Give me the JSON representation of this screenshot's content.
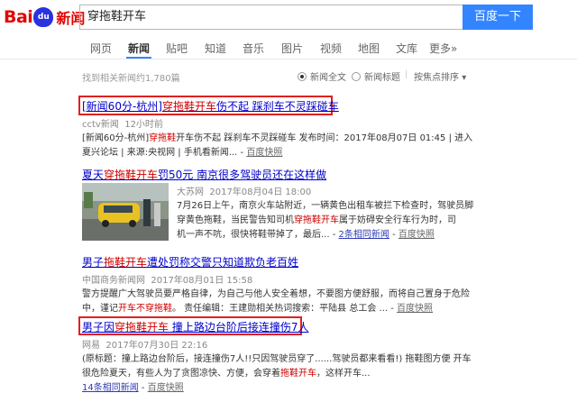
{
  "header": {
    "logo_text_1": "Bai",
    "logo_paw": "du",
    "logo_text_2": "新闻",
    "search_query": "穿拖鞋开车",
    "search_button": "百度一下"
  },
  "nav": {
    "items": [
      {
        "label": "网页"
      },
      {
        "label": "新闻"
      },
      {
        "label": "贴吧"
      },
      {
        "label": "知道"
      },
      {
        "label": "音乐"
      },
      {
        "label": "图片"
      },
      {
        "label": "视频"
      },
      {
        "label": "地图"
      },
      {
        "label": "文库"
      },
      {
        "label": "更多»"
      }
    ],
    "active": "新闻"
  },
  "toolbar": {
    "result_count": "找到相关新闻约1,780篇",
    "option_full": "新闻全文",
    "option_title": "新闻标题",
    "sort": "按焦点排序"
  },
  "results": [
    {
      "title_pre": "[新闻60分-杭州]",
      "title_em": "穿拖鞋开车",
      "title_post": "伤不起 踩刹车不灵踩碰车",
      "source": "cctv新闻",
      "time": "12小时前",
      "snippet_1_pre": "[新闻60分-杭州]",
      "snippet_1_em": "穿拖鞋",
      "snippet_1_post": "开车伤不起 踩刹车不灵踩碰车 发布时间：2017年08月07日 01:45 | 进入",
      "snippet_2": "夏兴论坛 | 来源:央视网 | 手机看新闻...",
      "cache": "百度快照"
    },
    {
      "title_pre": "夏天",
      "title_em": "穿拖鞋开车",
      "title_post": "罚50元 南京很多驾驶员还在这样做",
      "source": "大苏网",
      "time": "2017年08月04日 18:00",
      "snippet_1": "7月26日上午，南京火车站附近，一辆黄色出租车被拦下检查时，驾驶员脚",
      "snippet_2_pre": "穿黄色拖鞋，当民警告知司机",
      "snippet_2_em": "穿拖鞋开车",
      "snippet_2_post": "属于妨碍安全行车行为时，司",
      "snippet_3": "机一声不吭，很快将鞋带掉了，最后...",
      "related": "2条相同新闻",
      "cache": "百度快照"
    },
    {
      "title_pre": "男子",
      "title_em": "拖鞋开车",
      "title_post": "遭处罚称交警只知道欺负老百姓",
      "source": "中国商务新闻网",
      "time": "2017年08月01日 15:58",
      "snippet_1": "警方提醒广大驾驶员要严格自律，为自己与他人安全着想，不要图方便舒服，而将自己置身于危险",
      "snippet_2_pre": "中，谨记",
      "snippet_2_em": "开车不穿拖鞋",
      "snippet_2_post": "。 责任编辑：王建勋相关热词搜索：平陆县 总工会 ...",
      "cache": "百度快照"
    },
    {
      "title_pre": "男子因",
      "title_em": "穿拖鞋开车",
      "title_post": " 撞上路边台阶后接连撞伤7人",
      "source": "网易",
      "time": "2017年07月30日 22:16",
      "snippet_1": "(原标题：撞上路边台阶后，接连撞伤7人!!只因驾驶员穿了......驾驶员都来看看!) 拖鞋图方便 开车",
      "snippet_2_pre": "很危险夏天，有些人为了贪图凉快、方便，会穿着",
      "snippet_2_em": "拖鞋开车",
      "snippet_2_post": "，这样开车...",
      "related": "14条相同新闻",
      "cache": "百度快照"
    }
  ],
  "colors": {
    "accent": "#3385ff",
    "highlight_box": "#e02020",
    "link": "#0000cc",
    "em": "#cc0000"
  }
}
